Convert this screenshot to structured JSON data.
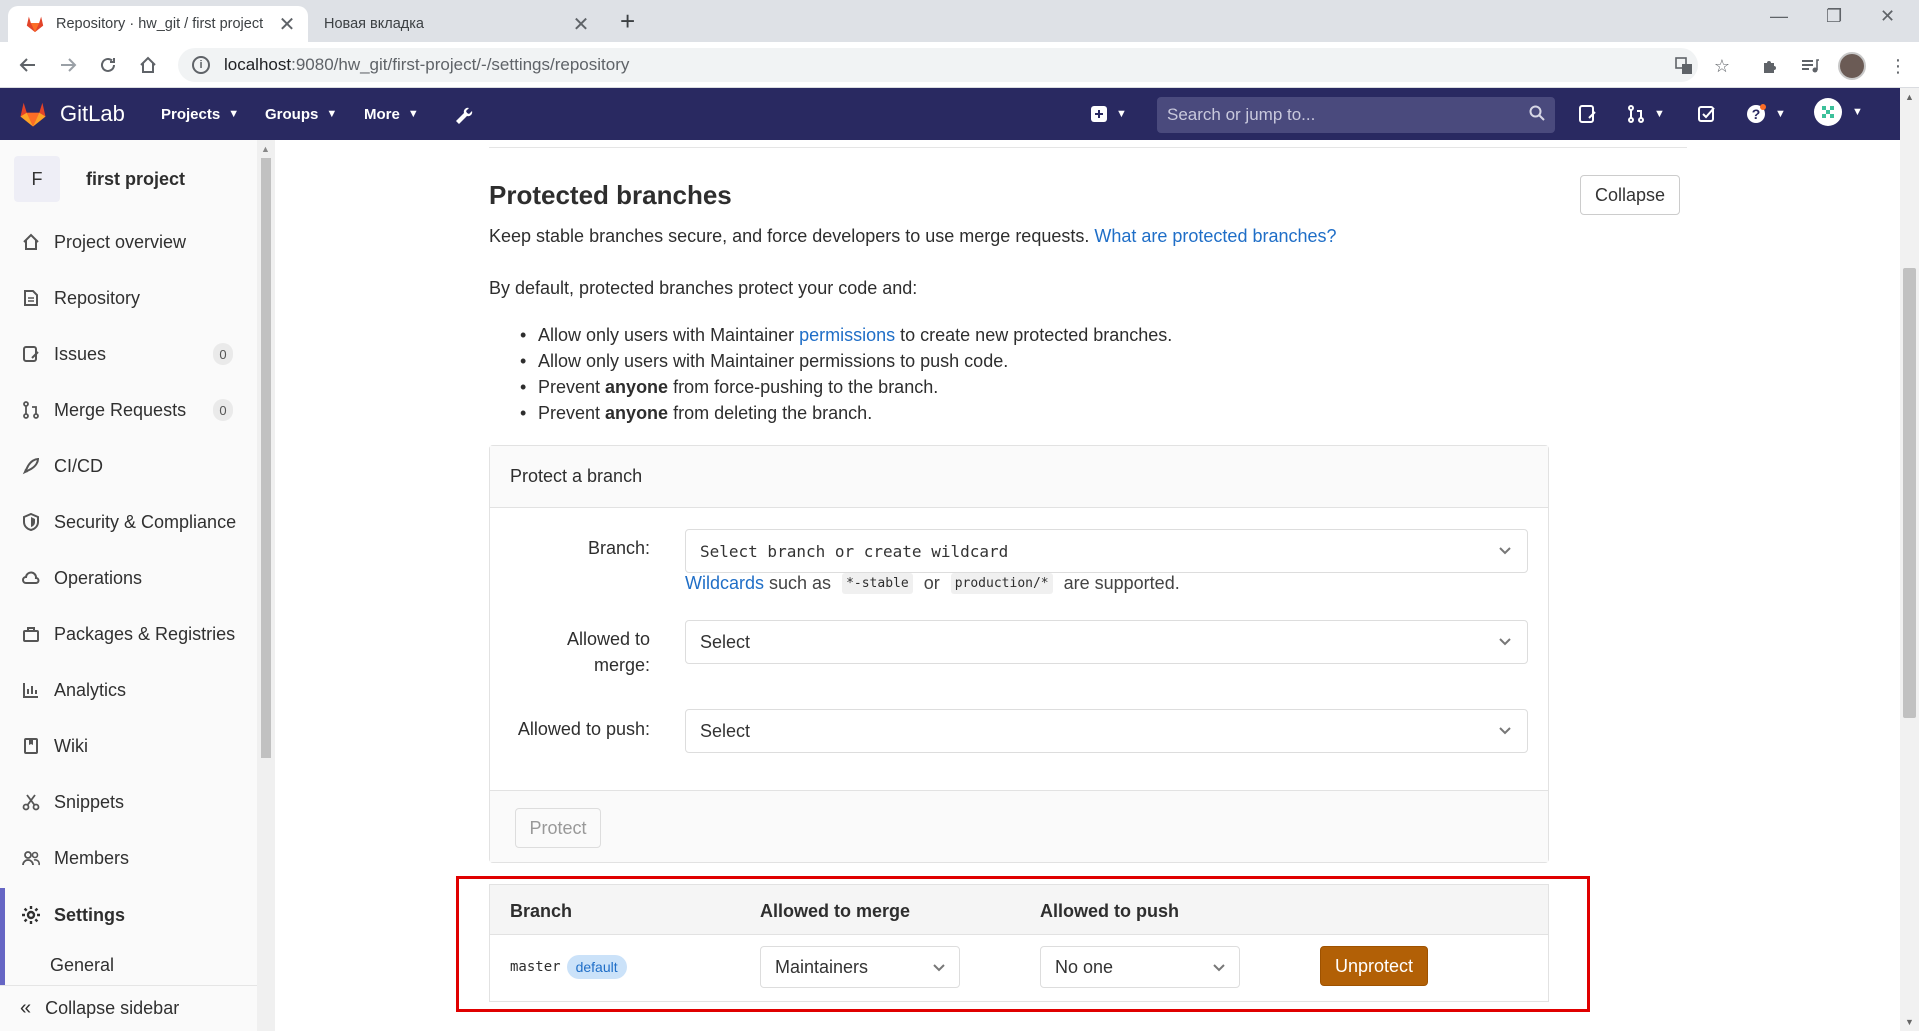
{
  "browser": {
    "active_tab_title": "Repository · hw_git / first project",
    "inactive_tab_title": "Новая вкладка",
    "url_host": "localhost",
    "url_path": ":9080/hw_git/first-project/-/settings/repository"
  },
  "header": {
    "brand": "GitLab",
    "nav": [
      "Projects",
      "Groups",
      "More"
    ],
    "search_placeholder": "Search or jump to..."
  },
  "sidebar": {
    "project_letter": "F",
    "project_name": "first project",
    "items": [
      {
        "label": "Project overview",
        "icon": "home-icon"
      },
      {
        "label": "Repository",
        "icon": "doc-icon"
      },
      {
        "label": "Issues",
        "icon": "issues-icon",
        "count": "0"
      },
      {
        "label": "Merge Requests",
        "icon": "merge-request-icon",
        "count": "0"
      },
      {
        "label": "CI/CD",
        "icon": "rocket-icon"
      },
      {
        "label": "Security & Compliance",
        "icon": "shield-icon"
      },
      {
        "label": "Operations",
        "icon": "cloud-gear-icon"
      },
      {
        "label": "Packages & Registries",
        "icon": "package-icon"
      },
      {
        "label": "Analytics",
        "icon": "chart-icon"
      },
      {
        "label": "Wiki",
        "icon": "book-icon"
      },
      {
        "label": "Snippets",
        "icon": "scissors-icon"
      },
      {
        "label": "Members",
        "icon": "users-icon"
      },
      {
        "label": "Settings",
        "icon": "gear-icon"
      }
    ],
    "sub_item": "General",
    "collapse_label": "Collapse sidebar"
  },
  "section": {
    "title": "Protected branches",
    "collapse_button": "Collapse",
    "description": "Keep stable branches secure, and force developers to use merge requests.",
    "help_link": "What are protected branches?",
    "default_intro": "By default, protected branches protect your code and:",
    "bullet1_pre": "Allow only users with Maintainer ",
    "bullet1_link": "permissions",
    "bullet1_post": " to create new protected branches.",
    "bullet2": "Allow only users with Maintainer permissions to push code.",
    "bullet3_pre": "Prevent ",
    "bullet3_bold": "anyone",
    "bullet3_post": " from force-pushing to the branch.",
    "bullet4_pre": "Prevent ",
    "bullet4_bold": "anyone",
    "bullet4_post": " from deleting the branch."
  },
  "protect_form": {
    "panel_title": "Protect a branch",
    "branch_label": "Branch:",
    "branch_placeholder": "Select branch or create wildcard",
    "hint_link": "Wildcards",
    "hint_such_as": " such as ",
    "hint_code1": "*-stable",
    "hint_or": " or ",
    "hint_code2": "production/*",
    "hint_post": " are supported.",
    "merge_label_1": "Allowed to",
    "merge_label_2": "merge:",
    "merge_value": "Select",
    "push_label": "Allowed to push:",
    "push_value": "Select",
    "protect_button": "Protect"
  },
  "protected_table": {
    "columns": [
      "Branch",
      "Allowed to merge",
      "Allowed to push"
    ],
    "rows": [
      {
        "branch": "master",
        "badge": "default",
        "allowed_to_merge": "Maintainers",
        "allowed_to_push": "No one",
        "action": "Unprotect"
      }
    ]
  },
  "colors": {
    "header_bg": "#292961",
    "link": "#1f6ec7",
    "unprotect_bg": "#b26006",
    "highlight": "#e00000"
  }
}
